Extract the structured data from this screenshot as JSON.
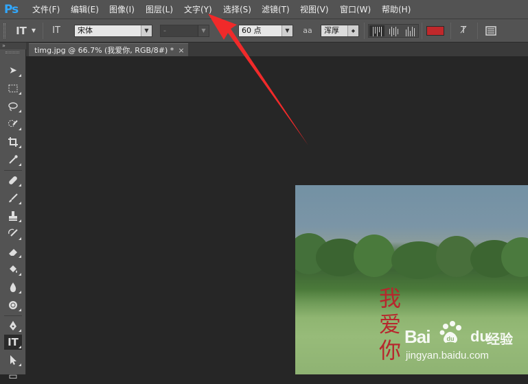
{
  "app": {
    "logo": "Ps",
    "menu": [
      "文件(F)",
      "编辑(E)",
      "图像(I)",
      "图层(L)",
      "文字(Y)",
      "选择(S)",
      "滤镜(T)",
      "视图(V)",
      "窗口(W)",
      "帮助(H)"
    ]
  },
  "options": {
    "tool_icon": "IT",
    "orient_icon": "IT",
    "font_family": "宋体",
    "font_style": "-",
    "size_icon": "T",
    "font_size": "60 点",
    "aa_icon": "aa",
    "antialias": "浑厚",
    "text_color": "#c0282b"
  },
  "document": {
    "tab_title": "timg.jpg @ 66.7% (我爱你, RGB/8#) *",
    "close_glyph": "×"
  },
  "canvas": {
    "vertical_text": [
      "我",
      "爱",
      "你"
    ],
    "text_color": "#b7272d"
  },
  "watermark": {
    "brand_left": "Bai",
    "brand_right": "du",
    "brand_cn": "经验",
    "url": "jingyan.baidu.com"
  },
  "colors": {
    "ui_panel": "#535353",
    "workspace": "#262626",
    "annotation_arrow": "#f02a2a"
  }
}
